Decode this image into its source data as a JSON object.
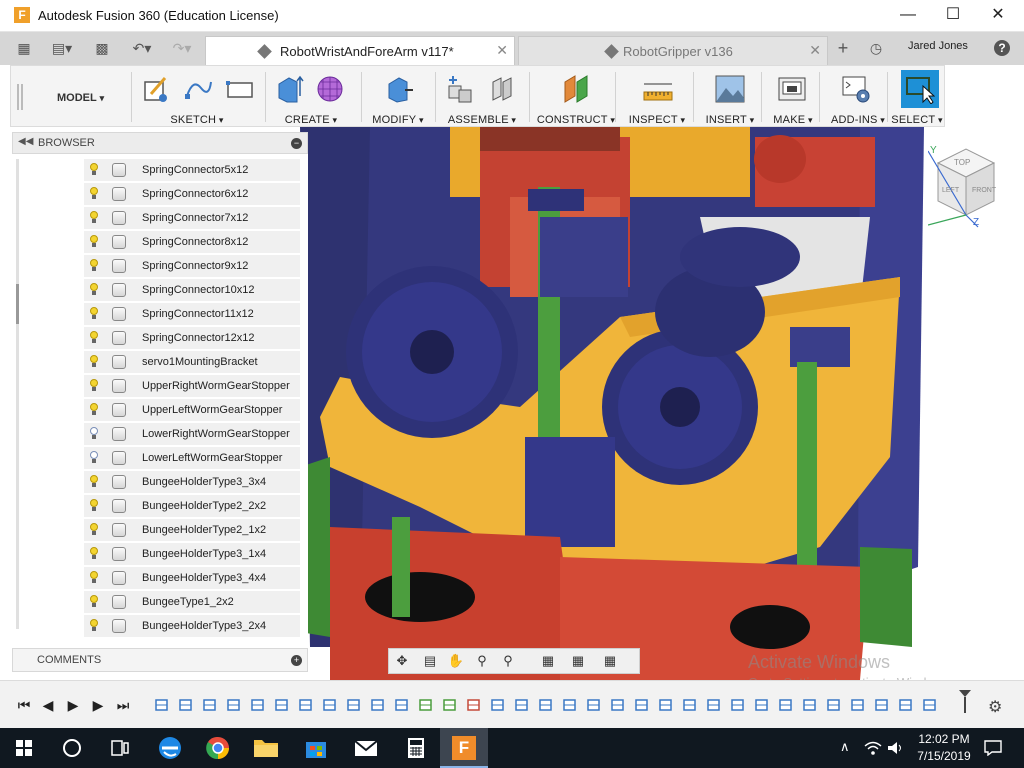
{
  "window": {
    "title": "Autodesk Fusion 360 (Education License)",
    "app_icon_letter": "F",
    "controls": [
      "minimize",
      "maximize",
      "close"
    ]
  },
  "tabs": [
    {
      "label": "RobotWristAndForeArm v117*",
      "active": true
    },
    {
      "label": "RobotGripper v136",
      "active": false
    }
  ],
  "user": {
    "name": "Jared Jones"
  },
  "toolbar": {
    "workspace": "MODEL",
    "groups": [
      "SKETCH",
      "CREATE",
      "MODIFY",
      "ASSEMBLE",
      "CONSTRUCT",
      "INSPECT",
      "INSERT",
      "MAKE",
      "ADD-INS",
      "SELECT"
    ]
  },
  "browser": {
    "header": "BROWSER",
    "items": [
      {
        "label": "SpringConnector5x12",
        "visible": true
      },
      {
        "label": "SpringConnector6x12",
        "visible": true
      },
      {
        "label": "SpringConnector7x12",
        "visible": true
      },
      {
        "label": "SpringConnector8x12",
        "visible": true
      },
      {
        "label": "SpringConnector9x12",
        "visible": true
      },
      {
        "label": "SpringConnector10x12",
        "visible": true
      },
      {
        "label": "SpringConnector11x12",
        "visible": true
      },
      {
        "label": "SpringConnector12x12",
        "visible": true
      },
      {
        "label": "servo1MountingBracket",
        "visible": true
      },
      {
        "label": "UpperRightWormGearStopper",
        "visible": true
      },
      {
        "label": "UpperLeftWormGearStopper",
        "visible": true
      },
      {
        "label": "LowerRightWormGearStopper",
        "visible": false
      },
      {
        "label": "LowerLeftWormGearStopper",
        "visible": false
      },
      {
        "label": "BungeeHolderType3_3x4",
        "visible": true
      },
      {
        "label": "BungeeHolderType2_2x2",
        "visible": true
      },
      {
        "label": "BungeeHolderType2_1x2",
        "visible": true
      },
      {
        "label": "BungeeHolderType3_1x4",
        "visible": true
      },
      {
        "label": "BungeeHolderType3_4x4",
        "visible": true
      },
      {
        "label": "BungeeType1_2x2",
        "visible": true
      },
      {
        "label": "BungeeHolderType3_2x4",
        "visible": true
      }
    ]
  },
  "comments": {
    "label": "COMMENTS"
  },
  "viewcube": {
    "top": "TOP",
    "front": "FRONT",
    "left": "LEFT",
    "axis_z": "Z",
    "axis_y": "Y"
  },
  "watermark": {
    "line1": "Activate Windows",
    "line2": "Go to Settings to activate Windows."
  },
  "taskbar": {
    "time": "12:02 PM",
    "date": "7/15/2019"
  },
  "colors": {
    "model_navy": "#3a3d86",
    "model_gold": "#f2b53c",
    "model_red": "#d24a38",
    "model_green": "#4a9c3c",
    "accent": "#1e90d6"
  }
}
